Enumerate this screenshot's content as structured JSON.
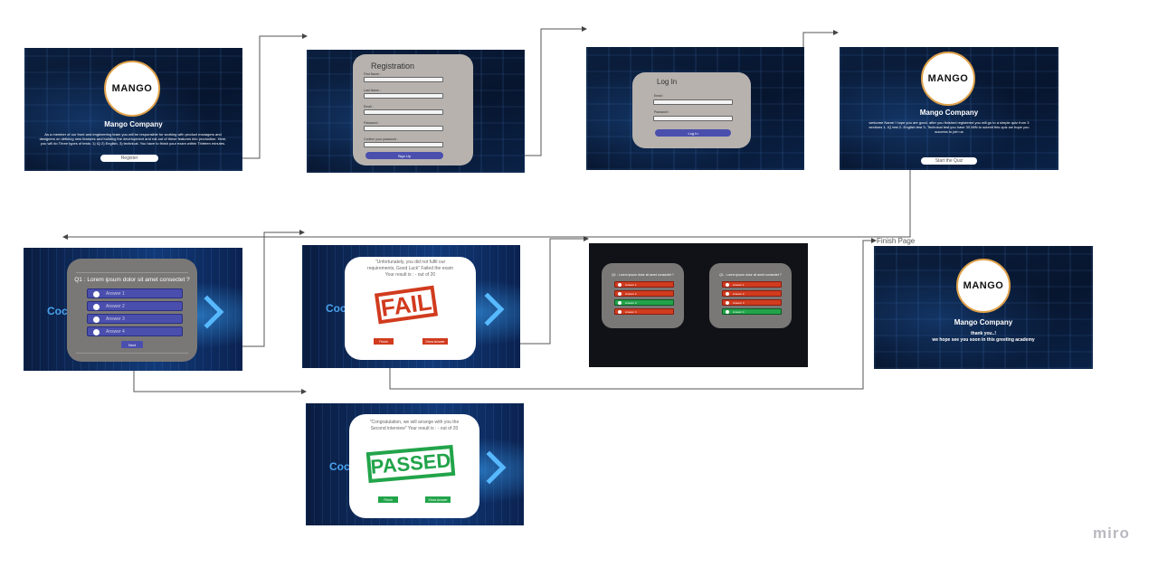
{
  "app": {
    "watermark": "miro"
  },
  "connector": {
    "label": "Finish Page"
  },
  "welcome": {
    "logo": "MANGO",
    "company": "Mango Company",
    "text": "As a member of our front and engineering team you will be responsible for working with product managers and designers on defining new features and building the development and roll-out of these features into production. Here, you will do Three types of tests: 1) IQ 2) English, 3) technical. You have to finish your exam within Thirteen minutes.",
    "button": "Register"
  },
  "registration": {
    "title": "Registration",
    "fields": [
      "First Name :",
      "Last Name :",
      "Email :",
      "Password :",
      "Confirm your password :"
    ],
    "button": "Sign Up"
  },
  "login": {
    "title": "Log In",
    "fields": [
      "Email :",
      "Password :"
    ],
    "button": "Log In"
  },
  "intro": {
    "logo": "MANGO",
    "company": "Mango Company",
    "text": "welcome Name ! hope you are good, after you finished registered you will go to a simple quiz from 3 sections 1- IQ test 2- English test 3- Technical test you have 30 MIN to submit this quiz we hope you success to join us",
    "button": "Start the Quiz"
  },
  "question": {
    "title": "Q1 : Lorem ipsum dolor sit amet consectet ?",
    "answers": [
      "Answer 1",
      "Answer 2",
      "Answer 3",
      "Answer 4"
    ],
    "button": "Next",
    "bg_text": "Coc"
  },
  "fail": {
    "text": "\"Unfortunately, you did not fulfil our requirements, Good Luck\" Failed the exam Your result is : - out of 20",
    "stamp": "FAIL",
    "finish": "Finish",
    "show": "Show Answer",
    "bg_text": "Coc"
  },
  "answers_review": {
    "title": "Q1 : Lorem ipsum dolor sit amet consectet ?",
    "left": [
      "Answer 1",
      "Answer 2",
      "Answer 3",
      "Answer 4"
    ],
    "right": [
      "Answer 1",
      "Answer 2",
      "Answer 3",
      "Answer 4"
    ]
  },
  "finish_page": {
    "logo": "MANGO",
    "company": "Mango Company",
    "line1": "thank you..!",
    "line2": "we hope see you soon in this greeting academy"
  },
  "pass": {
    "text": "\"Congratulation, we will arrange with you the Second interview\" Your result is : - out of 20",
    "stamp": "PASSED",
    "finish": "Finish",
    "show": "Show Answer",
    "bg_text": "Coc"
  },
  "colors": {
    "accent_purple": "#4a4fae",
    "fail_red": "#d13b1e",
    "pass_green": "#22a44a",
    "logo_ring": "#e0a24a"
  }
}
